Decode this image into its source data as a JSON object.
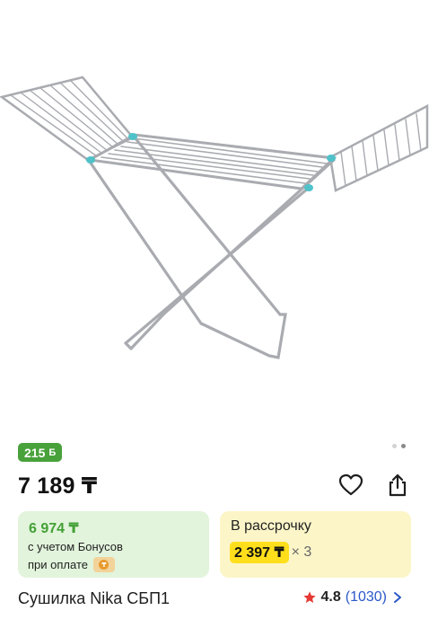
{
  "product": {
    "image_alt": "Сушилка Nika СБП1",
    "title": "Сушилка Nika СБП1",
    "bonus_badge": "215",
    "bonus_currency": "Б",
    "price": "7 189 ₸",
    "gallery_page": 2,
    "gallery_total": 2
  },
  "bonus_card": {
    "price": "6 974 ₸",
    "line1": "с учетом Бонусов",
    "line2": "при оплате"
  },
  "installment_card": {
    "title": "В рассрочку",
    "amount": "2 397 ₸",
    "multiplier": "× 3"
  },
  "rating": {
    "value": "4.8",
    "count": "(1030)"
  },
  "icons": {
    "favorite": "heart-icon",
    "share": "share-icon",
    "star": "star-icon",
    "chevron": "chevron-right-icon",
    "payment": "wallet-coin-icon"
  },
  "colors": {
    "bonus_green": "#48a13a",
    "bonus_card_bg": "#e2f4dc",
    "installment_card_bg": "#fbf5c8",
    "installment_highlight": "#ffdf1c",
    "rating_star": "#e53935",
    "link_blue": "#2a58c9"
  }
}
